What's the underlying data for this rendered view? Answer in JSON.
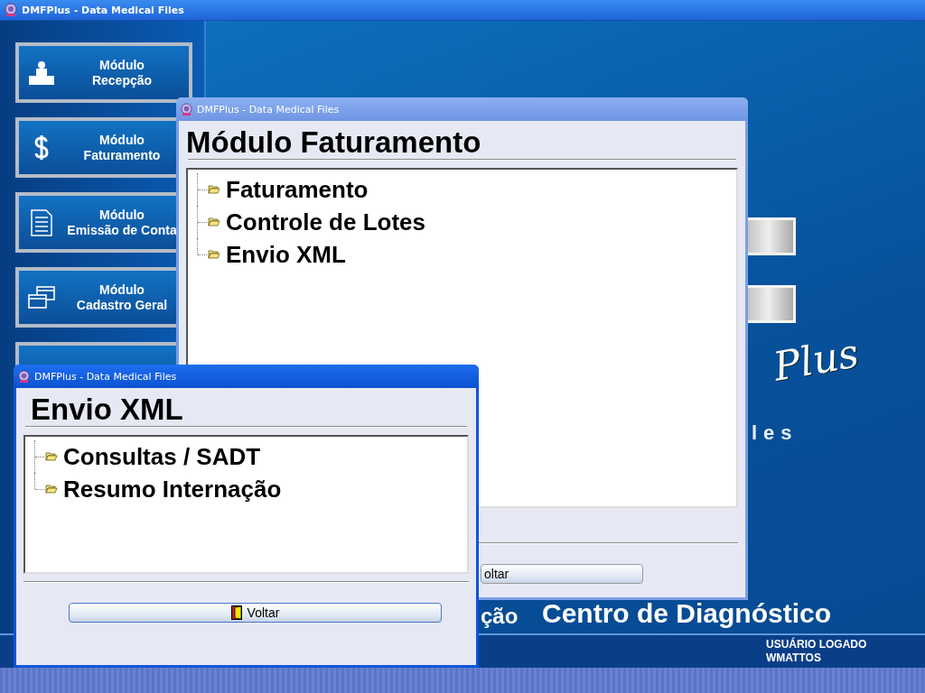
{
  "main_window": {
    "title": "DMFPlus - Data Medical Files"
  },
  "sidebar": {
    "items": [
      {
        "title": "Módulo",
        "subtitle": "Recepção"
      },
      {
        "title": "Módulo",
        "subtitle": "Faturamento"
      },
      {
        "title": "Módulo",
        "subtitle": "Emissão de Conta"
      },
      {
        "title": "Módulo",
        "subtitle": "Cadastro Geral"
      }
    ]
  },
  "logo": {
    "script_text": "Plus",
    "tail_text": "les"
  },
  "background_texts": {
    "fragment": "ção",
    "center_name": "Centro de Diagnóstico"
  },
  "status_bar": {
    "label": "USUÁRIO LOGADO",
    "user": "WMATTOS"
  },
  "windows": [
    {
      "title": "DMFPlus - Data Medical Files",
      "active": false,
      "heading": "Módulo Faturamento",
      "items": [
        "Faturamento",
        "Controle de Lotes",
        "Envio XML"
      ],
      "button": "oltar"
    },
    {
      "title": "DMFPlus - Data Medical Files",
      "active": true,
      "heading": "Envio XML",
      "items": [
        "Consultas / SADT",
        "Resumo Internação"
      ],
      "button": "Voltar"
    }
  ]
}
